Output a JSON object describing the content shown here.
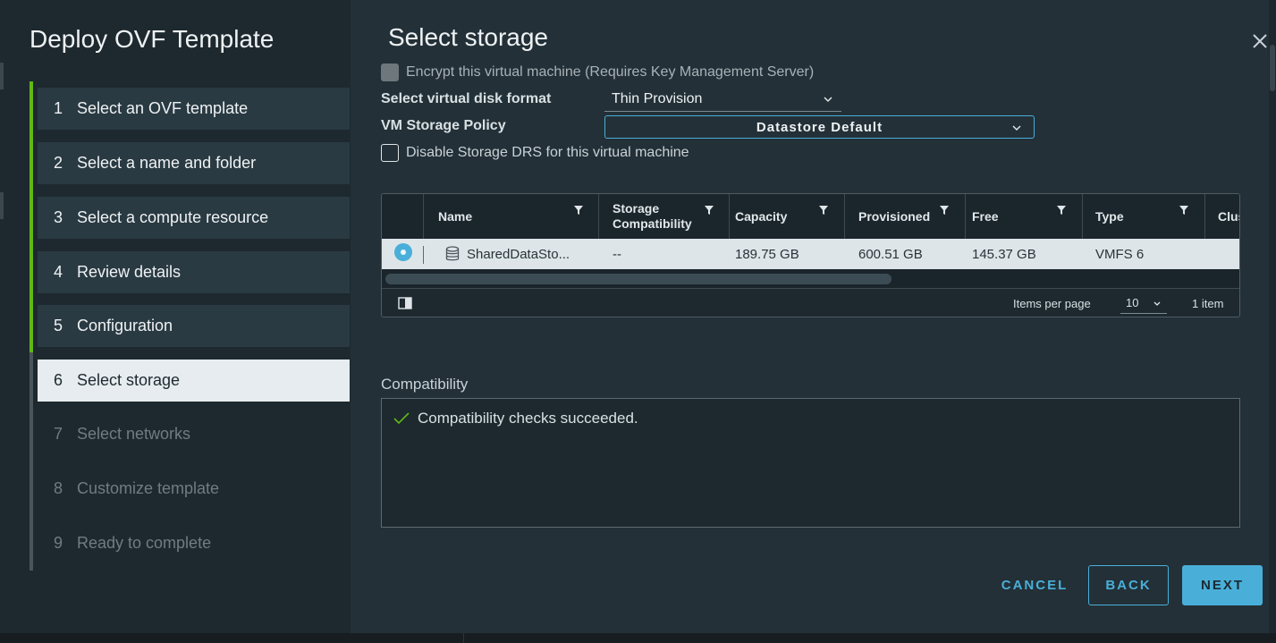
{
  "nav": {
    "title": "Deploy OVF Template",
    "steps": [
      {
        "num": "1",
        "label": "Select an OVF template"
      },
      {
        "num": "2",
        "label": "Select a name and folder"
      },
      {
        "num": "3",
        "label": "Select a compute resource"
      },
      {
        "num": "4",
        "label": "Review details"
      },
      {
        "num": "5",
        "label": "Configuration"
      },
      {
        "num": "6",
        "label": "Select storage"
      },
      {
        "num": "7",
        "label": "Select networks"
      },
      {
        "num": "8",
        "label": "Customize template"
      },
      {
        "num": "9",
        "label": "Ready to complete"
      }
    ],
    "active_step": 6
  },
  "main": {
    "title": "Select storage",
    "encrypt_label": "Encrypt this virtual machine (Requires Key Management Server)",
    "disk_format_label": "Select virtual disk format",
    "disk_format_value": "Thin Provision",
    "policy_label": "VM Storage Policy",
    "policy_value": "Datastore Default",
    "drs_label": "Disable Storage DRS for this virtual machine"
  },
  "grid": {
    "columns": [
      "Name",
      "Storage Compatibility",
      "Capacity",
      "Provisioned",
      "Free",
      "Type",
      "Clus"
    ],
    "columns_two_line": {
      "storage_compat_line1": "Storage",
      "storage_compat_line2": "Compatibility"
    },
    "rows": [
      {
        "name": "SharedDataSto...",
        "compatibility": "--",
        "capacity": "189.75 GB",
        "provisioned": "600.51 GB",
        "free": "145.37 GB",
        "type": "VMFS 6",
        "cluster": ""
      }
    ],
    "footer": {
      "items_per_page_label": "Items per page",
      "items_per_page_value": "10",
      "item_count": "1 item"
    }
  },
  "compatibility": {
    "label": "Compatibility",
    "message": "Compatibility checks succeeded."
  },
  "buttons": {
    "cancel": "CANCEL",
    "back": "BACK",
    "next": "NEXT"
  },
  "colors": {
    "accent": "#49afd9",
    "progress": "#61b715",
    "success": "#61b715"
  }
}
